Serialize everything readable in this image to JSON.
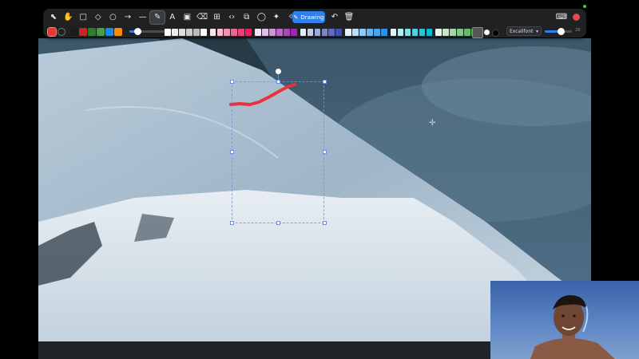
{
  "toolbar": {
    "tools": [
      {
        "name": "pointer-icon",
        "glyph": "⬉"
      },
      {
        "name": "hand-icon",
        "glyph": "✋"
      },
      {
        "name": "rectangle-icon",
        "glyph": "□"
      },
      {
        "name": "diamond-icon",
        "glyph": "◇"
      },
      {
        "name": "ellipse-icon",
        "glyph": "○"
      },
      {
        "name": "arrow-icon",
        "glyph": "→"
      },
      {
        "name": "line-icon",
        "glyph": "—"
      },
      {
        "name": "pen-icon",
        "glyph": "✎",
        "active": true
      },
      {
        "name": "text-icon",
        "glyph": "A"
      },
      {
        "name": "image-icon",
        "glyph": "▣"
      },
      {
        "name": "eraser-icon",
        "glyph": "⌫"
      },
      {
        "name": "grid-icon",
        "glyph": "⊞"
      },
      {
        "name": "code-icon",
        "glyph": "‹›"
      },
      {
        "name": "shapes-icon",
        "glyph": "⧉"
      },
      {
        "name": "comment-icon",
        "glyph": "◯"
      },
      {
        "name": "magic-icon",
        "glyph": "✦"
      },
      {
        "name": "laser-icon",
        "glyph": "✧"
      }
    ],
    "drawing_label": "Drawing",
    "undo_glyph": "↶",
    "trash_glyph": "🗑",
    "keyboard_glyph": "⌨",
    "font_name": "Excalifont",
    "size_value": "28"
  },
  "colors": {
    "accent": "#2f80ed",
    "stroke_color": "#e53935",
    "annotation_stroke": "#e8323c",
    "palette": [
      "#ffffff",
      "#eeeeee",
      "#dddddd",
      "#cccccc",
      "#bbbbbb",
      "#ffffff",
      "#fce4ec",
      "#f8bbd0",
      "#f48fb1",
      "#f06292",
      "#ec407a",
      "#e91e63",
      "#f3e5f5",
      "#e1bee7",
      "#ce93d8",
      "#ba68c8",
      "#ab47bc",
      "#9c27b0",
      "#e8eaf6",
      "#c5cae9",
      "#9fa8da",
      "#7986cb",
      "#5c6bc0",
      "#3f51b5",
      "#e3f2fd",
      "#bbdefb",
      "#90caf9",
      "#64b5f6",
      "#42a5f5",
      "#2196f3",
      "#e0f7fa",
      "#b2ebf2",
      "#80deea",
      "#4dd0e1",
      "#26c6da",
      "#00bcd4",
      "#e8f5e9",
      "#c8e6c9",
      "#a5d6a7",
      "#81c784",
      "#66bb6a",
      "#4caf50"
    ],
    "quick_colors": [
      "#e53935",
      "#2a2a2a",
      "#1b1b1b",
      "#c62828",
      "#2e7d32",
      "#43a047",
      "#1e88e5",
      "#fb8c00"
    ]
  },
  "sliders": {
    "stroke_level": 0.18,
    "size_level": 0.6
  }
}
